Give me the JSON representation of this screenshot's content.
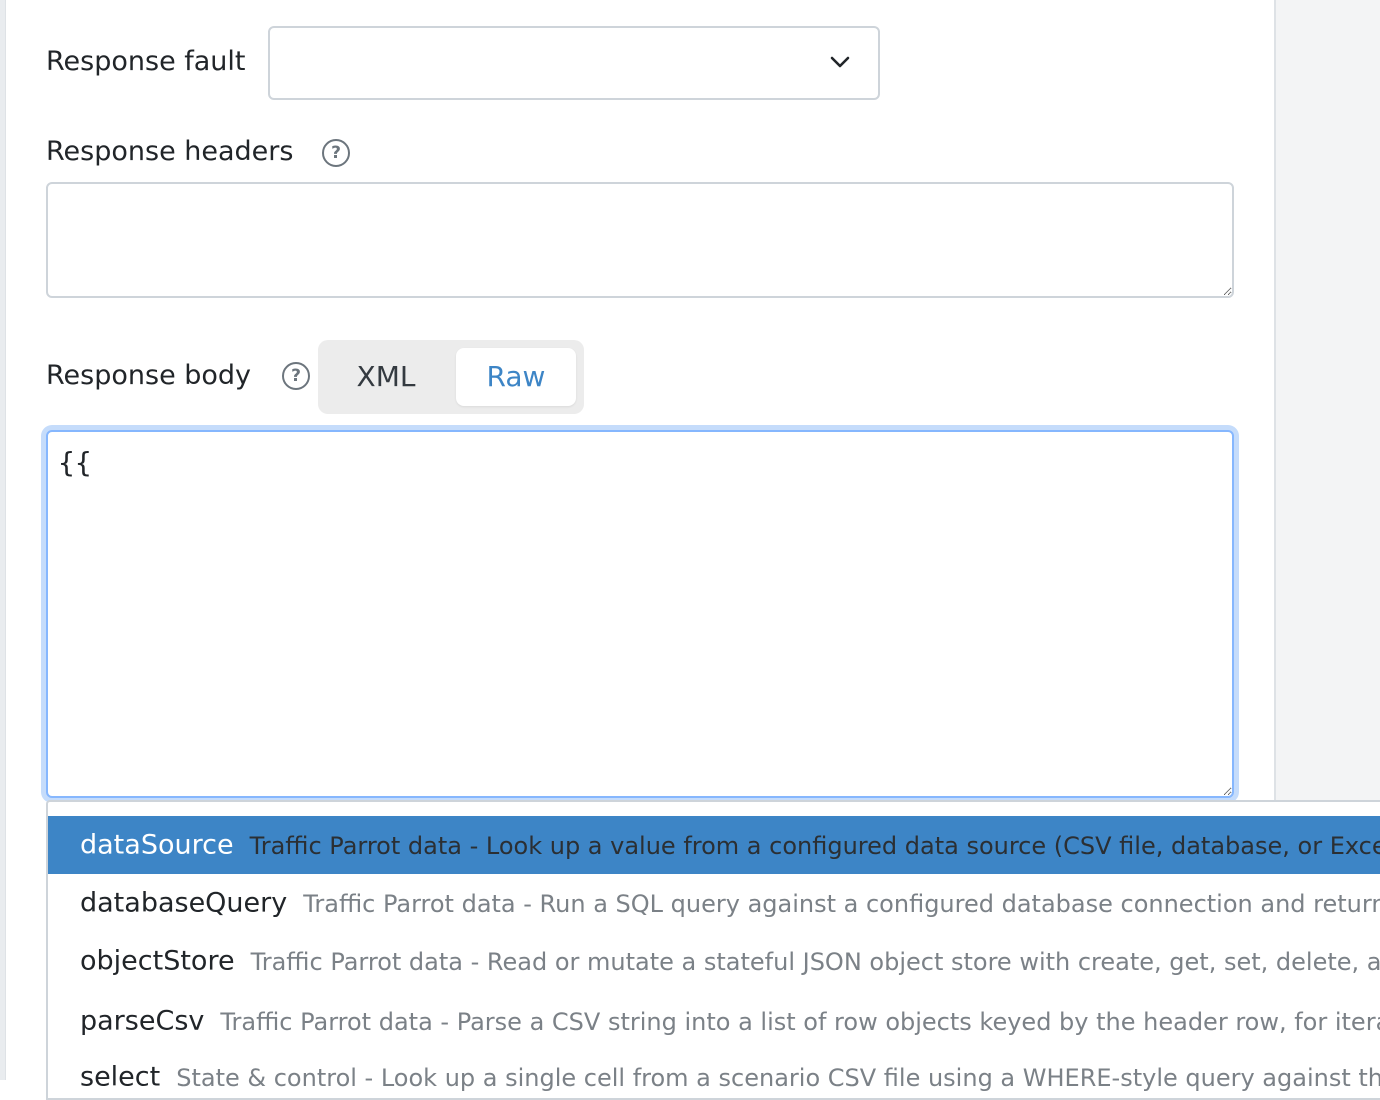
{
  "form": {
    "response_fault": {
      "label": "Response fault",
      "value": ""
    },
    "response_headers": {
      "label": "Response headers",
      "value": ""
    },
    "response_body": {
      "label": "Response body",
      "value": "{{",
      "modes": [
        "XML",
        "Raw"
      ],
      "selected_mode": "Raw"
    }
  },
  "autocomplete": {
    "items": [
      {
        "name": "dataSource",
        "desc": "Traffic Parrot data - Look up a value from a configured data source (CSV file, database, or Excel",
        "active": true
      },
      {
        "name": "databaseQuery",
        "desc": "Traffic Parrot data - Run a SQL query against a configured database connection and return",
        "active": false
      },
      {
        "name": "objectStore",
        "desc": "Traffic Parrot data - Read or mutate a stateful JSON object store with create, get, set, delete, a",
        "active": false
      },
      {
        "name": "parseCsv",
        "desc": "Traffic Parrot data - Parse a CSV string into a list of row objects keyed by the header row, for itera",
        "active": false
      },
      {
        "name": "select",
        "desc": "State & control - Look up a single cell from a scenario CSV file using a WHERE-style query against the",
        "active": false
      }
    ]
  },
  "colors": {
    "accent": "#3d85c6",
    "focus_ring": "#c5dcfb",
    "border": "#ced4da"
  },
  "icons": {
    "help": "question-circle-icon",
    "dropdown": "chevron-down-icon"
  }
}
